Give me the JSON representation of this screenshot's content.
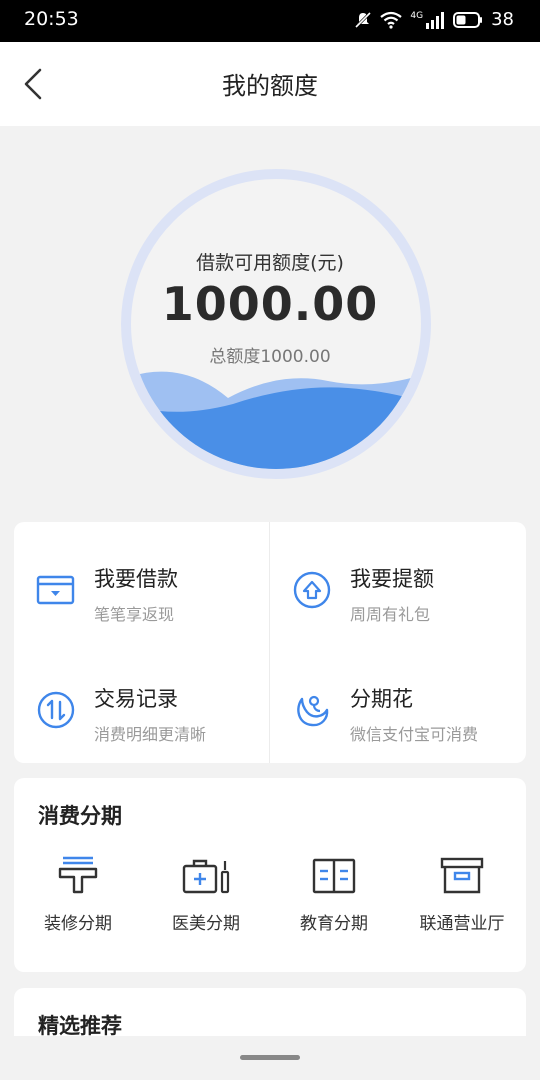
{
  "status_bar": {
    "time": "20:53",
    "network": "4G",
    "battery": "38"
  },
  "header": {
    "title": "我的额度"
  },
  "quota": {
    "label": "借款可用额度(元)",
    "value": "1000.00",
    "total": "总额度1000.00",
    "fill_fraction": 1.0
  },
  "actions": [
    {
      "title": "我要借款",
      "subtitle": "笔笔享返现",
      "icon": "card-icon"
    },
    {
      "title": "我要提额",
      "subtitle": "周周有礼包",
      "icon": "upgrade-icon"
    },
    {
      "title": "交易记录",
      "subtitle": "消费明细更清晰",
      "icon": "exchange-icon"
    },
    {
      "title": "分期花",
      "subtitle": "微信支付宝可消费",
      "icon": "moon-icon"
    }
  ],
  "installment": {
    "title": "消费分期",
    "items": [
      {
        "label": "装修分期",
        "icon": "paint-roller-icon"
      },
      {
        "label": "医美分期",
        "icon": "medical-kit-icon"
      },
      {
        "label": "教育分期",
        "icon": "book-icon"
      },
      {
        "label": "联通营业厅",
        "icon": "box-icon"
      }
    ]
  },
  "recommend": {
    "title": "精选推荐"
  },
  "colors": {
    "accent": "#3f86ea",
    "wave": "#4a8fe7",
    "ring": "#dce3f6"
  }
}
